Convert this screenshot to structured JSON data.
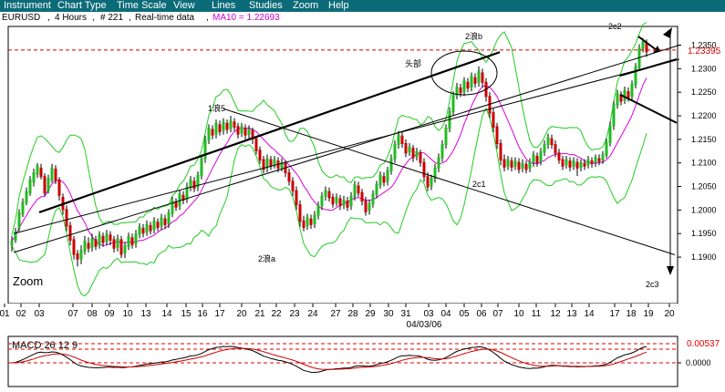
{
  "menu": [
    "Instrument",
    "Chart Type",
    "Time Scale",
    "View",
    "Lines",
    "Studies",
    "Zoom",
    "Help"
  ],
  "info": {
    "symbol": "EURUSD",
    "interval": "4 Hours",
    "count": "# 221",
    "feed": "Real-time data",
    "ma_text": "MA10 = 1.22693"
  },
  "zoom_label": "Zoom",
  "chart_data": {
    "type": "candlestick",
    "y_axis_ticks": [
      "1.2350",
      "1.2300",
      "1.2250",
      "1.2200",
      "1.2150",
      "1.2100",
      "1.2050",
      "1.2000",
      "1.1950",
      "1.1900"
    ],
    "price_marker": "1.23395",
    "ylim": [
      1.187,
      1.2405
    ],
    "x_ticks": [
      "01",
      "02",
      "03",
      "07",
      "08",
      "09",
      "10",
      "13",
      "14",
      "15",
      "16",
      "17",
      "20",
      "21",
      "22",
      "23",
      "24",
      "27",
      "28",
      "29",
      "30",
      "31",
      "03",
      "04",
      "05",
      "06",
      "07",
      "10",
      "11",
      "12",
      "13",
      "14",
      "17",
      "18",
      "19",
      "20"
    ],
    "date_label": "04/03/06",
    "annotations": [
      "1浪5",
      "头部",
      "2浪b",
      "2c1",
      "2浪a",
      "2c2",
      "2c3"
    ],
    "macd": {
      "label": "MACD 26 12 9",
      "ticks": [
        "0.00537",
        "0.0000"
      ]
    }
  }
}
